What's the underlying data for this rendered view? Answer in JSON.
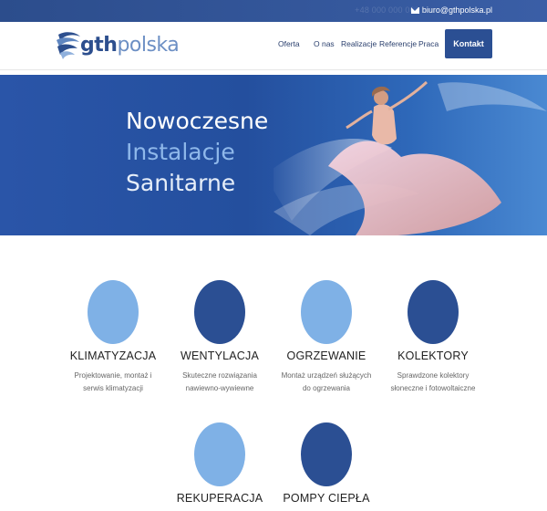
{
  "topbar": {
    "phone": "+48 000 000 000",
    "email": "biuro@gthpolska.pl"
  },
  "header": {
    "logo_text_a": "gth",
    "logo_text_b": "polska",
    "nav": [
      "Oferta",
      "O nas",
      "Realizacje",
      "Referencje",
      "Praca"
    ],
    "cta": "Kontakt"
  },
  "hero": {
    "line1": "Nowoczesne",
    "line2": "Instalacje",
    "line3": "Sanitarne"
  },
  "services": [
    {
      "title": "KLIMATYZACJA",
      "desc1": "Projektowanie, montaż i",
      "desc2": "serwis klimatyzacji",
      "color": "#7fb1e6"
    },
    {
      "title": "WENTYLACJA",
      "desc1": "Skuteczne rozwiązania",
      "desc2": "nawiewno-wywiewne",
      "color": "#2b4f93"
    },
    {
      "title": "OGRZEWANIE",
      "desc1": "Montaż urządzeń służących",
      "desc2": "do ogrzewania",
      "color": "#7fb1e6"
    },
    {
      "title": "KOLEKTORY",
      "desc1": "Sprawdzone kolektory",
      "desc2": "słoneczne i fotowoltaiczne",
      "color": "#2b4f93"
    },
    {
      "title": "REKUPERACJA",
      "color": "#7fb1e6"
    },
    {
      "title": "POMPY CIEPŁA",
      "color": "#2b4f93"
    }
  ],
  "colors": {
    "brand_dark": "#2b4f93",
    "brand_light": "#7fb1e6"
  }
}
